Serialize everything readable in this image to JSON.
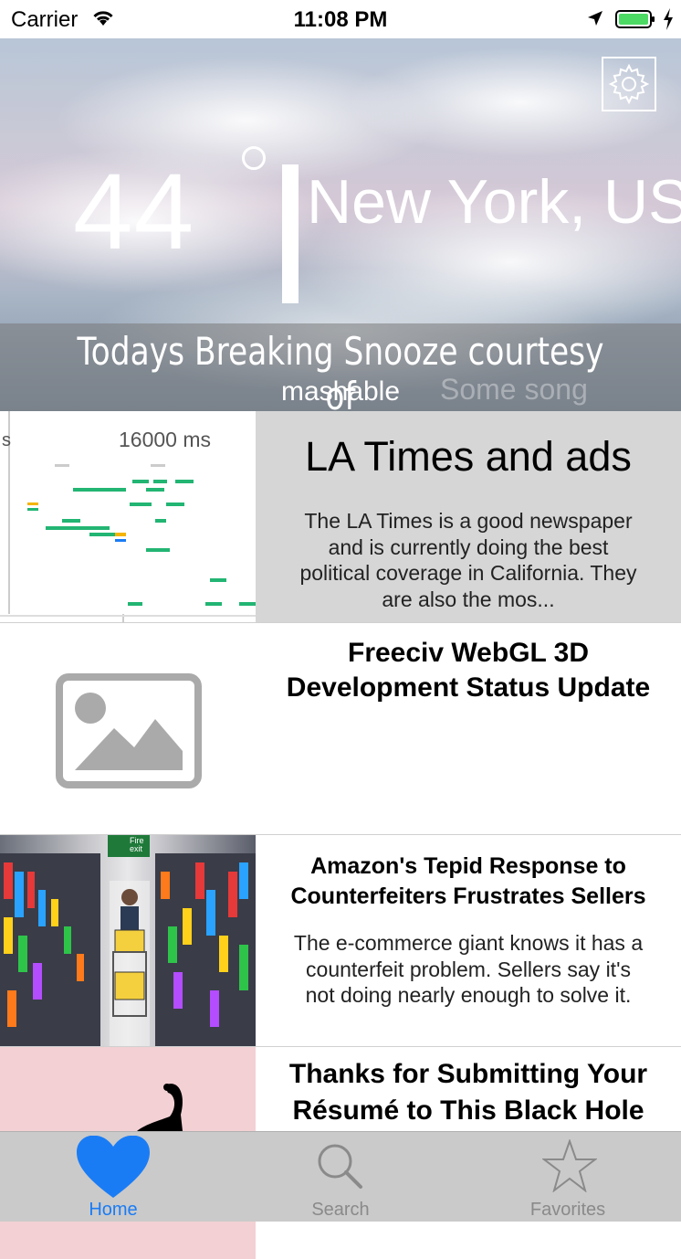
{
  "status_bar": {
    "carrier": "Carrier",
    "time": "11:08 PM"
  },
  "weather": {
    "temperature": "44",
    "city": "New York, US"
  },
  "banner": {
    "headline": "Todays Breaking Snooze courtesy of",
    "source": "mashable",
    "background_text": "Some song"
  },
  "articles": [
    {
      "title": "LA Times and ads",
      "description": "The LA Times is a good newspaper and is currently doing the best political coverage in California. They are also the mos...",
      "thumb_label": "16000 ms"
    },
    {
      "title": "Freeciv WebGL 3D Development Status Update",
      "description": ""
    },
    {
      "title": "Amazon's Tepid Response to Counterfeiters Frustrates Sellers",
      "description": "The e-commerce giant knows it has a counterfeit problem. Sellers say it's not doing nearly enough to solve it.",
      "thumb_sign": "Fire exit"
    },
    {
      "title": "Thanks for Submitting Your Résumé to This Black Hole",
      "description": ""
    }
  ],
  "tabs": [
    {
      "label": "Home",
      "icon": "heart-icon",
      "active": true
    },
    {
      "label": "Search",
      "icon": "magnifier-icon",
      "active": false
    },
    {
      "label": "Favorites",
      "icon": "star-icon",
      "active": false
    }
  ],
  "colors": {
    "accent": "#1a7cf5",
    "inactive_tab": "#8a8a8a",
    "tab_bar": "#cacaca",
    "row1_bg": "#d6d6d6",
    "row4_thumb_bg": "#f2d0d3"
  }
}
